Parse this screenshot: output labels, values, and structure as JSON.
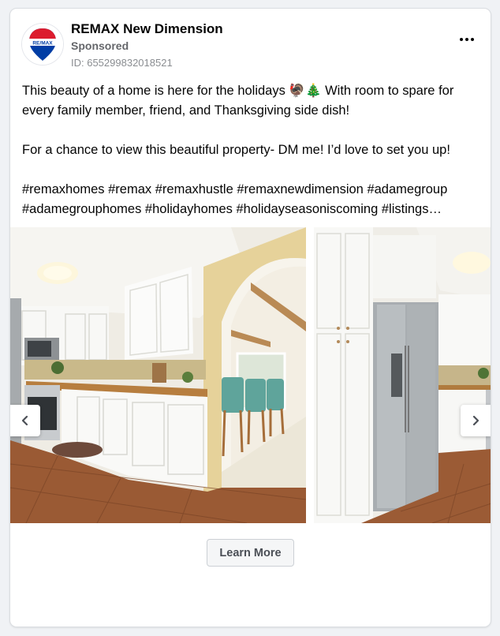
{
  "post": {
    "page_name": "REMAX New Dimension",
    "sponsored_label": "Sponsored",
    "ad_id": "ID: 655299832018521",
    "avatar_text": "RE/MAX",
    "more_icon": "ellipsis-icon",
    "body": {
      "line1": "This beauty of a home is here for the holidays 🦃🎄 With room to spare for",
      "line2": "every family member, friend, and Thanksgiving side dish!",
      "line3": "For a chance to view this beautiful property- DM me! I’d love to set you up!",
      "line4": "#remaxhomes #remax #remaxhustle #remaxnewdimension #adamegroup",
      "line5": "#adamegrouphomes #holidayhomes #holidayseasoniscoming #listings…"
    }
  },
  "carousel": {
    "slides": [
      "kitchen-photo",
      "refrigerator-photo"
    ],
    "prev_icon": "chevron-left-icon",
    "next_icon": "chevron-right-icon"
  },
  "cta": {
    "label": "Learn More"
  },
  "colors": {
    "remax_red": "#dc1c2e",
    "remax_blue": "#003da5",
    "card_bg": "#ffffff"
  }
}
